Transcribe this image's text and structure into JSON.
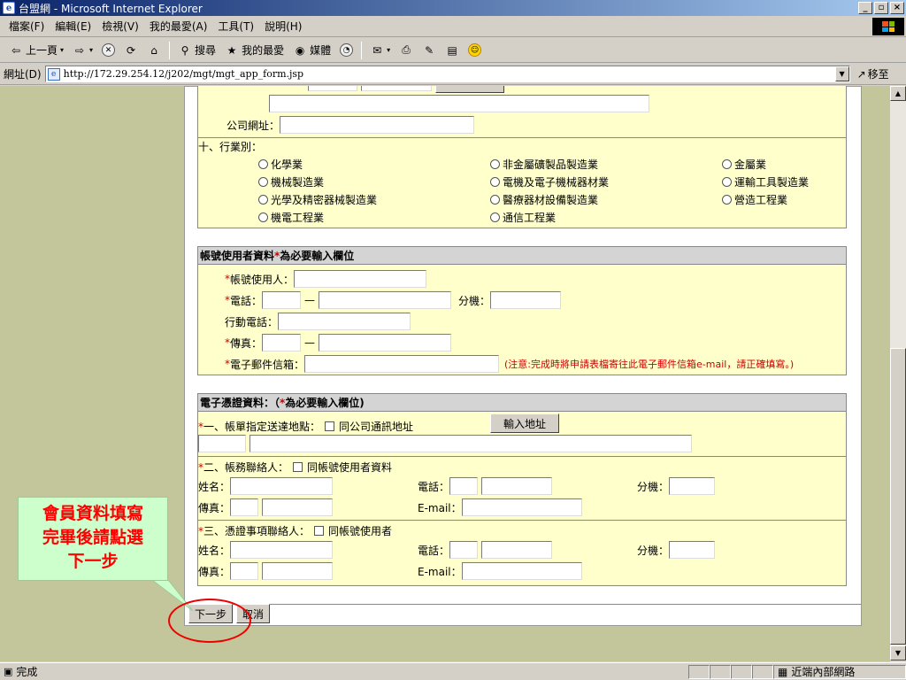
{
  "window": {
    "title": "台盟網 - Microsoft Internet Explorer",
    "controls": [
      "_",
      "▫",
      "×"
    ]
  },
  "menu": [
    "檔案(F)",
    "編輯(E)",
    "檢視(V)",
    "我的最愛(A)",
    "工具(T)",
    "說明(H)"
  ],
  "toolbar": {
    "back": "上一頁",
    "search": "搜尋",
    "favorites": "我的最愛",
    "media": "媒體"
  },
  "address": {
    "label": "網址(D)",
    "url": "http://172.29.254.12/j202/mgt/mgt_app_form.jsp",
    "go": "移至"
  },
  "company": {
    "website_label": "公司網址：",
    "industry_label": "十、行業別：",
    "industries": [
      [
        "化學業",
        "非金屬礦製品製造業",
        "金屬業"
      ],
      [
        "機械製造業",
        "電機及電子機械器材業",
        "運輸工具製造業"
      ],
      [
        "光學及精密器械製造業",
        "醫療器材設備製造業",
        "營造工程業"
      ],
      [
        "機電工程業",
        "通信工程業",
        ""
      ]
    ]
  },
  "account": {
    "header_prefix": "帳號使用者資料 ",
    "header_star": "*",
    "header_suffix": "為必要輸入欄位",
    "star": "*",
    "user_label": "帳號使用人：",
    "phone_label": "電話：",
    "dash": "—",
    "ext_label": "分機：",
    "mobile_label": "行動電話：",
    "fax_label": "傳真：",
    "email_label": "電子郵件信箱：",
    "email_note": "(注意:完成時將申請表檔寄往此電子郵件信箱e-mail，請正確填寫。)"
  },
  "cert": {
    "header_prefix": "電子憑證資料：（",
    "header_star": "*",
    "header_suffix": "為必要輸入欄位)",
    "star": "*",
    "delivery_label": "一、帳單指定送達地點：",
    "delivery_check": "同公司通訊地址",
    "address_button": "輸入地址",
    "billing_label": "二、帳務聯絡人：",
    "billing_check": "同帳號使用者資料",
    "cert_label": "三、憑證事項聯絡人：",
    "cert_check": "同帳號使用者",
    "name_label": "姓名：",
    "phone_label": "電話：",
    "ext_label": "分機：",
    "fax_label": "傳真：",
    "email_label": "E-mail："
  },
  "buttons": {
    "next": "下一步",
    "cancel": "取消"
  },
  "callout": [
    "會員資料填寫",
    "完畢後請點選",
    "下一步"
  ],
  "status": {
    "text": "完成",
    "zone": "近端內部網路"
  }
}
